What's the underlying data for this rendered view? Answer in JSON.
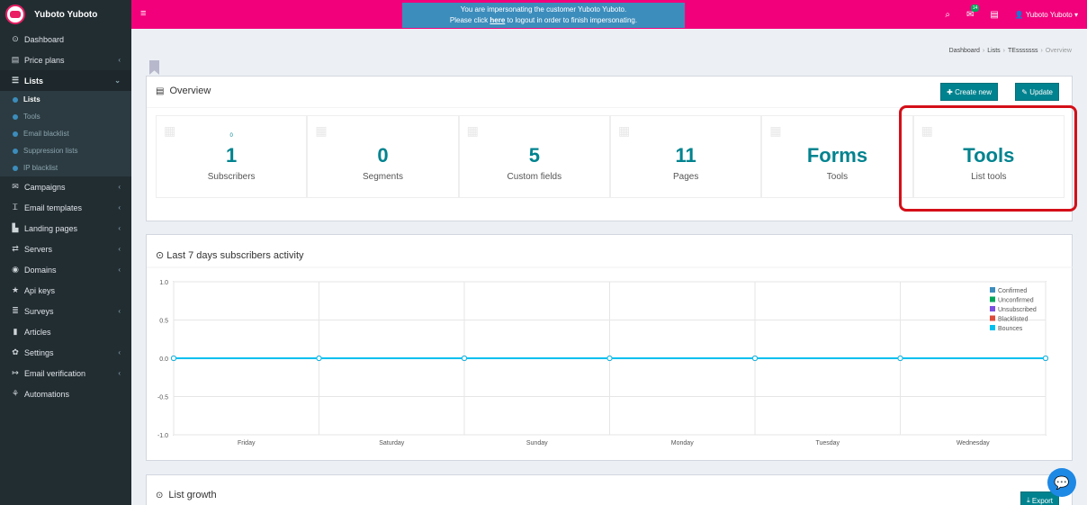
{
  "brand": {
    "name": "Yuboto Yuboto"
  },
  "sidebar": {
    "items": [
      {
        "label": "Dashboard",
        "icon": "dashboard-icon",
        "glyph": "⊙",
        "chev": ""
      },
      {
        "label": "Price plans",
        "icon": "price-icon",
        "glyph": "▤",
        "chev": "‹"
      },
      {
        "label": "Lists",
        "icon": "list-icon",
        "glyph": "☰",
        "chev": "⌄"
      }
    ],
    "sub": [
      {
        "label": "Lists"
      },
      {
        "label": "Tools"
      },
      {
        "label": "Email blacklist"
      },
      {
        "label": "Suppression lists"
      },
      {
        "label": "IP blacklist"
      }
    ],
    "items2": [
      {
        "label": "Campaigns",
        "icon": "envelope-icon",
        "glyph": "✉",
        "chev": "‹"
      },
      {
        "label": "Email templates",
        "icon": "text-icon",
        "glyph": "Ꮖ",
        "chev": "‹"
      },
      {
        "label": "Landing pages",
        "icon": "page-icon",
        "glyph": "▙",
        "chev": "‹"
      },
      {
        "label": "Servers",
        "icon": "exchange-icon",
        "glyph": "⇄",
        "chev": "‹"
      },
      {
        "label": "Domains",
        "icon": "globe-icon",
        "glyph": "◉",
        "chev": "‹"
      },
      {
        "label": "Api keys",
        "icon": "star-icon",
        "glyph": "★",
        "chev": ""
      },
      {
        "label": "Surveys",
        "icon": "list-icon",
        "glyph": "≣",
        "chev": "‹"
      },
      {
        "label": "Articles",
        "icon": "book-icon",
        "glyph": "▮",
        "chev": ""
      },
      {
        "label": "Settings",
        "icon": "cog-icon",
        "glyph": "✿",
        "chev": "‹"
      },
      {
        "label": "Email verification",
        "icon": "check-icon",
        "glyph": "↦",
        "chev": "‹"
      },
      {
        "label": "Automations",
        "icon": "automation-icon",
        "glyph": "⚘",
        "chev": ""
      }
    ]
  },
  "topbar": {
    "imp_line1": "You are impersonating the customer Yuboto Yuboto.",
    "imp_pre": "Please click",
    "imp_link": "here",
    "imp_post": "to logout in order to finish impersonating.",
    "badge": "14",
    "user": "Yuboto Yuboto"
  },
  "breadcrumb": [
    "Dashboard",
    "Lists",
    "TEsssssss",
    "Overview"
  ],
  "overview": {
    "title": "Overview",
    "create": "Create new",
    "update": "Update",
    "stats": [
      {
        "small": "0",
        "big": "1",
        "label": "Subscribers",
        "icon": "users-icon"
      },
      {
        "small": "",
        "big": "0",
        "label": "Segments",
        "icon": "cog-icon"
      },
      {
        "small": "",
        "big": "5",
        "label": "Custom fields",
        "icon": "list-icon"
      },
      {
        "small": "",
        "big": "11",
        "label": "Pages",
        "icon": "folder-icon"
      },
      {
        "small": "",
        "big": "Forms",
        "label": "Tools",
        "icon": "form-icon"
      },
      {
        "small": "",
        "big": "Tools",
        "label": "List tools",
        "icon": "tools-icon"
      }
    ]
  },
  "activity": {
    "title": "Last 7 days subscribers activity"
  },
  "chart_data": {
    "type": "line",
    "x": [
      "Friday",
      "Saturday",
      "Sunday",
      "Monday",
      "Tuesday",
      "Wednesday"
    ],
    "ylim": [
      -1.0,
      1.0
    ],
    "yticks": [
      "1.0",
      "0.5",
      "0.0",
      "-0.5",
      "-1.0"
    ],
    "series": [
      {
        "name": "Confirmed",
        "color": "#3c8dbc",
        "values": [
          0,
          0,
          0,
          0,
          0,
          0,
          0
        ]
      },
      {
        "name": "Unconfirmed",
        "color": "#00a65a",
        "values": [
          0,
          0,
          0,
          0,
          0,
          0,
          0
        ]
      },
      {
        "name": "Unsubscribed",
        "color": "#7b4fe0",
        "values": [
          0,
          0,
          0,
          0,
          0,
          0,
          0
        ]
      },
      {
        "name": "Blacklisted",
        "color": "#dd4b39",
        "values": [
          0,
          0,
          0,
          0,
          0,
          0,
          0
        ]
      },
      {
        "name": "Bounces",
        "color": "#00c0ef",
        "values": [
          0,
          0,
          0,
          0,
          0,
          0,
          0
        ]
      }
    ],
    "legend": "top-right",
    "grid": true
  },
  "growth": {
    "title": "List growth",
    "export": "Export"
  }
}
